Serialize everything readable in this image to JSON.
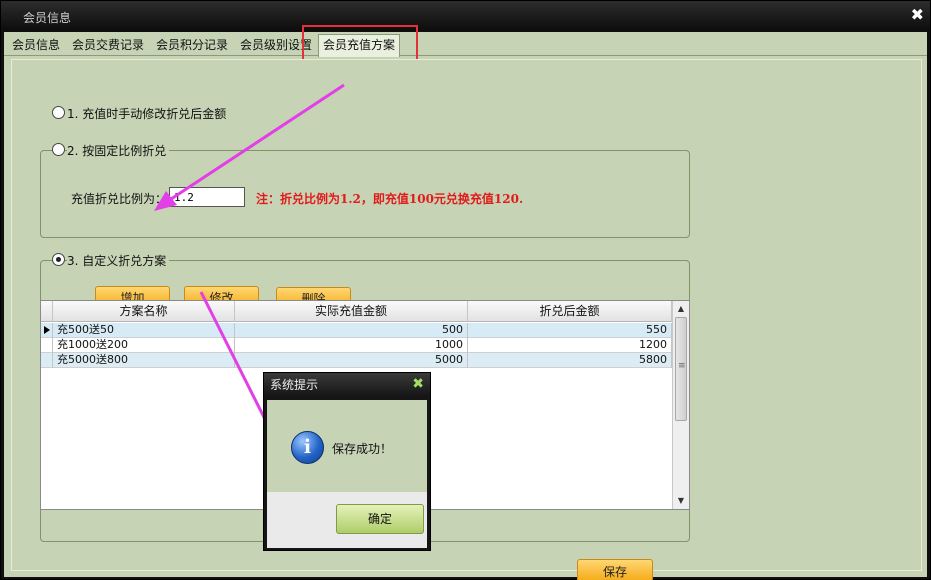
{
  "window": {
    "title": "会员信息",
    "close_symbol": "✖"
  },
  "tabs": [
    {
      "label": "会员信息"
    },
    {
      "label": "会员交费记录"
    },
    {
      "label": "会员积分记录"
    },
    {
      "label": "会员级别设置"
    },
    {
      "label": "会员充值方案",
      "active": true
    }
  ],
  "options": {
    "opt1": {
      "label": "1. 充值时手动修改折兑后金额",
      "checked": false
    },
    "opt2": {
      "label": "2. 按固定比例折兑",
      "checked": false
    },
    "opt3": {
      "label": "3. 自定义折兑方案",
      "checked": true
    }
  },
  "ratio": {
    "label": "充值折兑比例为：",
    "value": "1.2",
    "note": "注：折兑比例为1.2，即充值100元兑换充值120."
  },
  "buttons": {
    "add": "增加",
    "edit": "修改",
    "delete": "删除",
    "save": "保存"
  },
  "table": {
    "columns": [
      "方案名称",
      "实际充值金额",
      "折兑后金额"
    ],
    "rows": [
      {
        "name": "充500送50",
        "amount": "500",
        "converted": "550"
      },
      {
        "name": "充1000送200",
        "amount": "1000",
        "converted": "1200"
      },
      {
        "name": "充5000送800",
        "amount": "5000",
        "converted": "5800"
      }
    ]
  },
  "dialog": {
    "title": "系统提示",
    "close_symbol": "✖",
    "message": "保存成功！",
    "ok": "确定",
    "icon_letter": "i"
  },
  "colors": {
    "accent_orange": "#f3a40b",
    "annotation_red": "#e4303a",
    "annotation_magenta": "#e23fe6",
    "panel_green": "#c6d3b5"
  }
}
